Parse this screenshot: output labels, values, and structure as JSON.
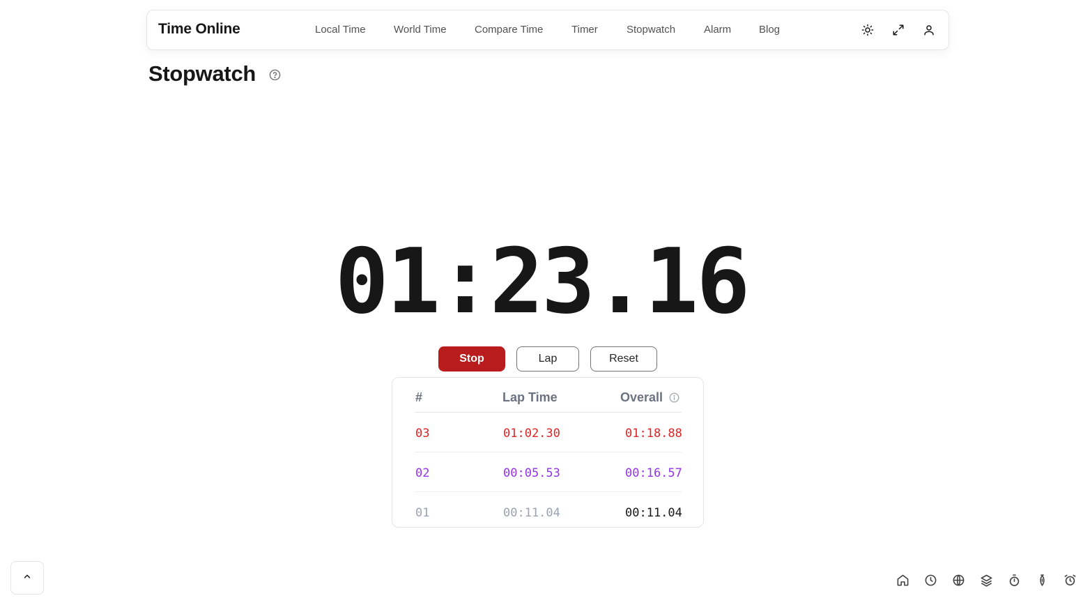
{
  "brand": "Time Online",
  "nav": {
    "links": [
      "Local Time",
      "World Time",
      "Compare Time",
      "Timer",
      "Stopwatch",
      "Alarm",
      "Blog"
    ],
    "icons": [
      "sun-icon",
      "expand-icon",
      "user-icon"
    ]
  },
  "page": {
    "title": "Stopwatch",
    "help_icon": "help-circle-icon"
  },
  "stopwatch": {
    "display": "01:23.16",
    "buttons": {
      "stop": "Stop",
      "lap": "Lap",
      "reset": "Reset"
    }
  },
  "laps": {
    "headers": {
      "number": "#",
      "lap_time": "Lap Time",
      "overall": "Overall"
    },
    "rows": [
      {
        "number": "03",
        "lap_time": "01:02.30",
        "overall": "01:18.88",
        "color": "#dc2626",
        "overall_color": "#dc2626"
      },
      {
        "number": "02",
        "lap_time": "00:05.53",
        "overall": "00:16.57",
        "color": "#9333ea",
        "overall_color": "#9333ea"
      },
      {
        "number": "01",
        "lap_time": "00:11.04",
        "overall": "00:11.04",
        "color": "#9ca3af",
        "overall_color": "#171717"
      }
    ]
  },
  "dock": [
    "home-icon",
    "clock-icon",
    "globe-icon",
    "layers-icon",
    "stopwatch-icon",
    "timer-icon",
    "alarm-icon"
  ],
  "colors": {
    "stop_button": "#b91c1c",
    "fastest": "#9333ea",
    "slowest": "#dc2626"
  }
}
